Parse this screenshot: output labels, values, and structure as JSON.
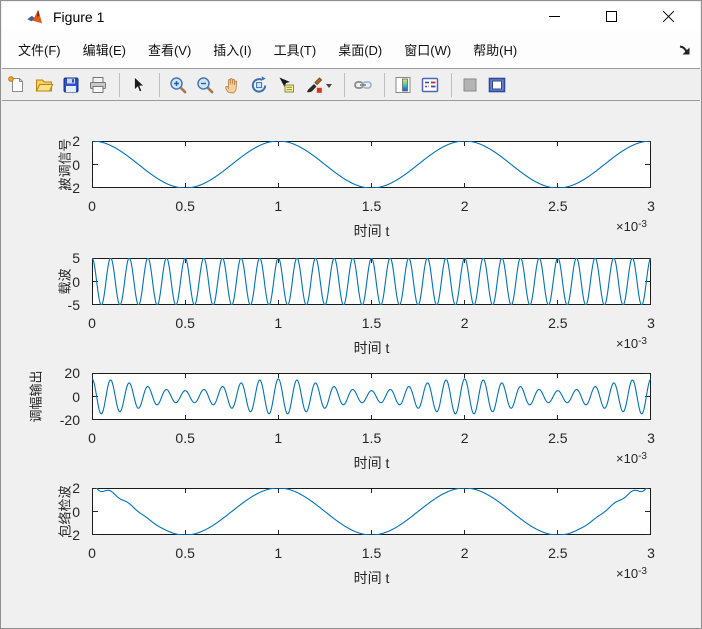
{
  "window": {
    "title": "Figure 1",
    "controls": {
      "minimize": "minimize",
      "maximize": "maximize",
      "close": "close"
    }
  },
  "menu": {
    "items": [
      "文件(F)",
      "编辑(E)",
      "查看(V)",
      "插入(I)",
      "工具(T)",
      "桌面(D)",
      "窗口(W)",
      "帮助(H)"
    ],
    "dock_arrow": "dock-figure-arrow"
  },
  "toolbar": {
    "buttons": [
      "new-figure",
      "open-file",
      "save-figure",
      "print-figure",
      "edit-plot",
      "zoom-in",
      "zoom-out",
      "pan",
      "rotate-3d",
      "data-cursor",
      "brush-data",
      "link-plot",
      "insert-colorbar",
      "insert-legend",
      "hide-plot-tools",
      "show-plot-tools"
    ]
  },
  "figure": {
    "background": "#f0f0f0",
    "axes_background": "#ffffff",
    "axes_edge_color": "#1a1a1a",
    "line_color": "#0072BD",
    "text_color": "#262626"
  },
  "chart_data": [
    {
      "type": "line",
      "ylabel": "被调信号",
      "xlabel": "时间 t",
      "x_exponent": {
        "base": "×10",
        "power": "-3"
      },
      "xlim": [
        0,
        0.003
      ],
      "ylim": [
        -2,
        2
      ],
      "xtick_labels": [
        "0",
        "0.5",
        "1",
        "1.5",
        "2",
        "2.5",
        "3"
      ],
      "ytick_labels": [
        "-2",
        "0",
        "2"
      ],
      "ytick_values": [
        -2,
        0,
        2
      ],
      "line_color": "#0072BD",
      "signal": {
        "kind": "cos",
        "amplitude": 2,
        "freq_hz": 1000,
        "description": "2*cos(2*pi*1000*t)"
      }
    },
    {
      "type": "line",
      "ylabel": "载波",
      "xlabel": "时间 t",
      "x_exponent": {
        "base": "×10",
        "power": "-3"
      },
      "xlim": [
        0,
        0.003
      ],
      "ylim": [
        -5,
        5
      ],
      "xtick_labels": [
        "0",
        "0.5",
        "1",
        "1.5",
        "2",
        "2.5",
        "3"
      ],
      "ytick_labels": [
        "-5",
        "0",
        "5"
      ],
      "ytick_values": [
        -5,
        0,
        5
      ],
      "line_color": "#0072BD",
      "signal": {
        "kind": "cos",
        "amplitude": 5,
        "freq_hz": 10000,
        "description": "5*cos(2*pi*10000*t)"
      }
    },
    {
      "type": "line",
      "ylabel": "调幅输出",
      "xlabel": "时间 t",
      "x_exponent": {
        "base": "×10",
        "power": "-3"
      },
      "xlim": [
        0,
        0.003
      ],
      "ylim": [
        -20,
        20
      ],
      "xtick_labels": [
        "0",
        "0.5",
        "1",
        "1.5",
        "2",
        "2.5",
        "3"
      ],
      "ytick_labels": [
        "-20",
        "0",
        "20"
      ],
      "ytick_values": [
        -20,
        0,
        20
      ],
      "line_color": "#0072BD",
      "signal": {
        "kind": "am",
        "carrier_amp": 10,
        "mod_amp": 5,
        "mod_freq_hz": 1000,
        "carrier_freq_hz": 10000,
        "description": "(10+5*cos(2*pi*1000*t))*cos(2*pi*10000*t)"
      }
    },
    {
      "type": "line",
      "ylabel": "包络检波",
      "xlabel": "时间 t",
      "x_exponent": {
        "base": "×10",
        "power": "-3"
      },
      "xlim": [
        0,
        0.003
      ],
      "ylim": [
        -2,
        2
      ],
      "xtick_labels": [
        "0",
        "0.5",
        "1",
        "1.5",
        "2",
        "2.5",
        "3"
      ],
      "ytick_labels": [
        "-2",
        "0",
        "2"
      ],
      "ytick_values": [
        -2,
        0,
        2
      ],
      "line_color": "#0072BD",
      "signal": {
        "kind": "demod",
        "amplitude": 2,
        "mod_freq_hz": 1000,
        "ripple_amp": 0.3,
        "ripple_freq_hz": 10000,
        "edge_tau_s": 0.00012,
        "description": "2*cos(2*pi*1000*t) + edge filter ripple"
      }
    }
  ]
}
